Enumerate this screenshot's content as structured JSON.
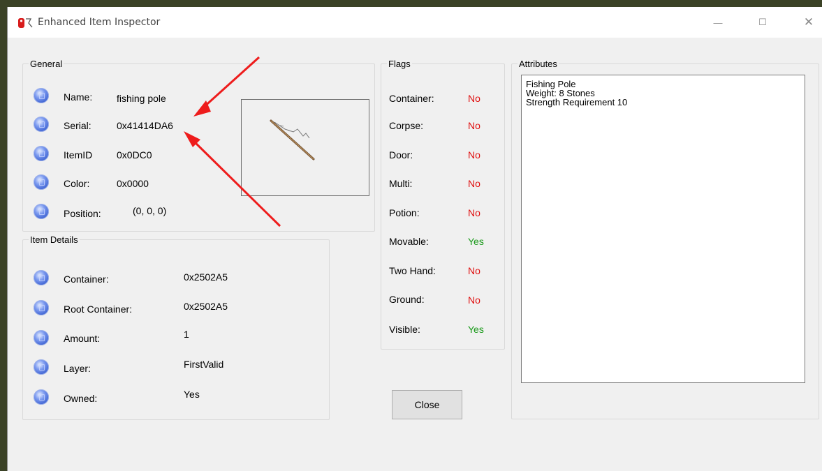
{
  "window": {
    "title": "Enhanced Item Inspector",
    "controls": {
      "minimize": "—",
      "maximize": "☐",
      "close": "✕"
    }
  },
  "general": {
    "label": "General",
    "rows": [
      {
        "label": "Name:",
        "value": "fishing pole"
      },
      {
        "label": "Serial:",
        "value": "0x41414DA6"
      },
      {
        "label": "ItemID",
        "value": "0x0DC0"
      },
      {
        "label": "Color:",
        "value": "0x0000"
      },
      {
        "label": "Position:",
        "value": "(0, 0, 0)"
      }
    ],
    "preview_icon": "fishing-pole-icon"
  },
  "item_details": {
    "label": "Item Details",
    "rows": [
      {
        "label": "Container:",
        "value": "0x2502A5"
      },
      {
        "label": "Root Container:",
        "value": "0x2502A5"
      },
      {
        "label": "Amount:",
        "value": "1"
      },
      {
        "label": "Layer:",
        "value": "FirstValid"
      },
      {
        "label": "Owned:",
        "value": "Yes"
      }
    ]
  },
  "flags": {
    "label": "Flags",
    "rows": [
      {
        "label": "Container:",
        "value": "No"
      },
      {
        "label": "Corpse:",
        "value": "No"
      },
      {
        "label": "Door:",
        "value": "No"
      },
      {
        "label": "Multi:",
        "value": "No"
      },
      {
        "label": "Potion:",
        "value": "No"
      },
      {
        "label": "Movable:",
        "value": "Yes"
      },
      {
        "label": "Two Hand:",
        "value": "No"
      },
      {
        "label": "Ground:",
        "value": "No"
      },
      {
        "label": "Visible:",
        "value": "Yes"
      }
    ]
  },
  "attributes": {
    "label": "Attributes",
    "lines": [
      "Fishing Pole",
      "Weight: 8 Stones",
      "Strength Requirement 10"
    ]
  },
  "close_button": {
    "label": "Close"
  },
  "colors": {
    "no": "#e01010",
    "yes": "#1a9a1a",
    "arrow": "#ee1c1c"
  }
}
